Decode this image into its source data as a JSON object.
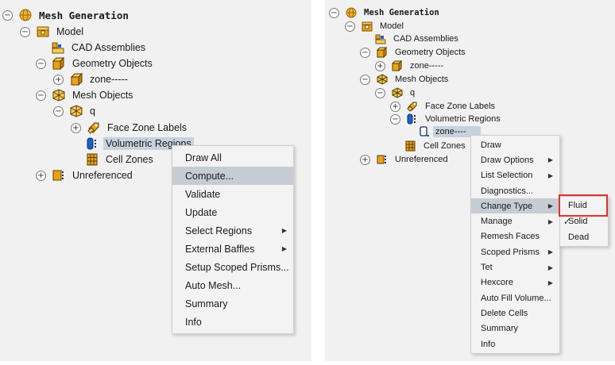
{
  "colors": {
    "panel_bg": "#f1f1f1",
    "selected_bg": "#c7d2de",
    "menu_highlight": "#c6ccd4",
    "highlight_box": "#e0332e",
    "icon_gold": "#e8a317",
    "icon_blue": "#1f5fc8"
  },
  "left_tree": {
    "root": "Mesh Generation",
    "model": "Model",
    "cad_assemblies": "CAD Assemblies",
    "geometry_objects": "Geometry Objects",
    "zone": "zone-----",
    "mesh_objects": "Mesh Objects",
    "q": "q",
    "face_zone_labels": "Face Zone Labels",
    "volumetric_regions": "Volumetric Regions",
    "cell_zones": "Cell Zones",
    "unreferenced": "Unreferenced"
  },
  "left_menu": {
    "items": [
      {
        "label": "Draw All"
      },
      {
        "label": "Compute..."
      },
      {
        "label": "Validate"
      },
      {
        "label": "Update"
      },
      {
        "label": "Select Regions"
      },
      {
        "label": "External Baffles"
      },
      {
        "label": "Setup Scoped Prisms..."
      },
      {
        "label": "Auto Mesh..."
      },
      {
        "label": "Summary"
      },
      {
        "label": "Info"
      }
    ],
    "highlighted": "Compute..."
  },
  "right_tree": {
    "root": "Mesh Generation",
    "model": "Model",
    "cad_assemblies": "CAD Assemblies",
    "geometry_objects": "Geometry Objects",
    "zone": "zone-----",
    "mesh_objects": "Mesh Objects",
    "q": "q",
    "face_zone_labels": "Face Zone Labels",
    "volumetric_regions": "Volumetric Regions",
    "region_zone": "zone----",
    "cell_zones": "Cell Zones",
    "unreferenced": "Unreferenced"
  },
  "right_menu": {
    "items": [
      {
        "label": "Draw"
      },
      {
        "label": "Draw Options"
      },
      {
        "label": "List Selection"
      },
      {
        "label": "Diagnostics..."
      },
      {
        "label": "Change Type"
      },
      {
        "label": "Manage"
      },
      {
        "label": "Remesh Faces"
      },
      {
        "label": "Scoped Prisms"
      },
      {
        "label": "Tet"
      },
      {
        "label": "Hexcore"
      },
      {
        "label": "Auto Fill Volume..."
      },
      {
        "label": "Delete Cells"
      },
      {
        "label": "Summary"
      },
      {
        "label": "Info"
      }
    ],
    "highlighted": "Change Type"
  },
  "change_type_submenu": {
    "items": [
      {
        "label": "Fluid"
      },
      {
        "label": "Solid"
      },
      {
        "label": "Dead"
      }
    ],
    "checked": "Solid",
    "check_mark": "✓"
  },
  "glyphs": {
    "expanded": "−",
    "collapsed": "+",
    "submenu_arrow": "▶"
  }
}
